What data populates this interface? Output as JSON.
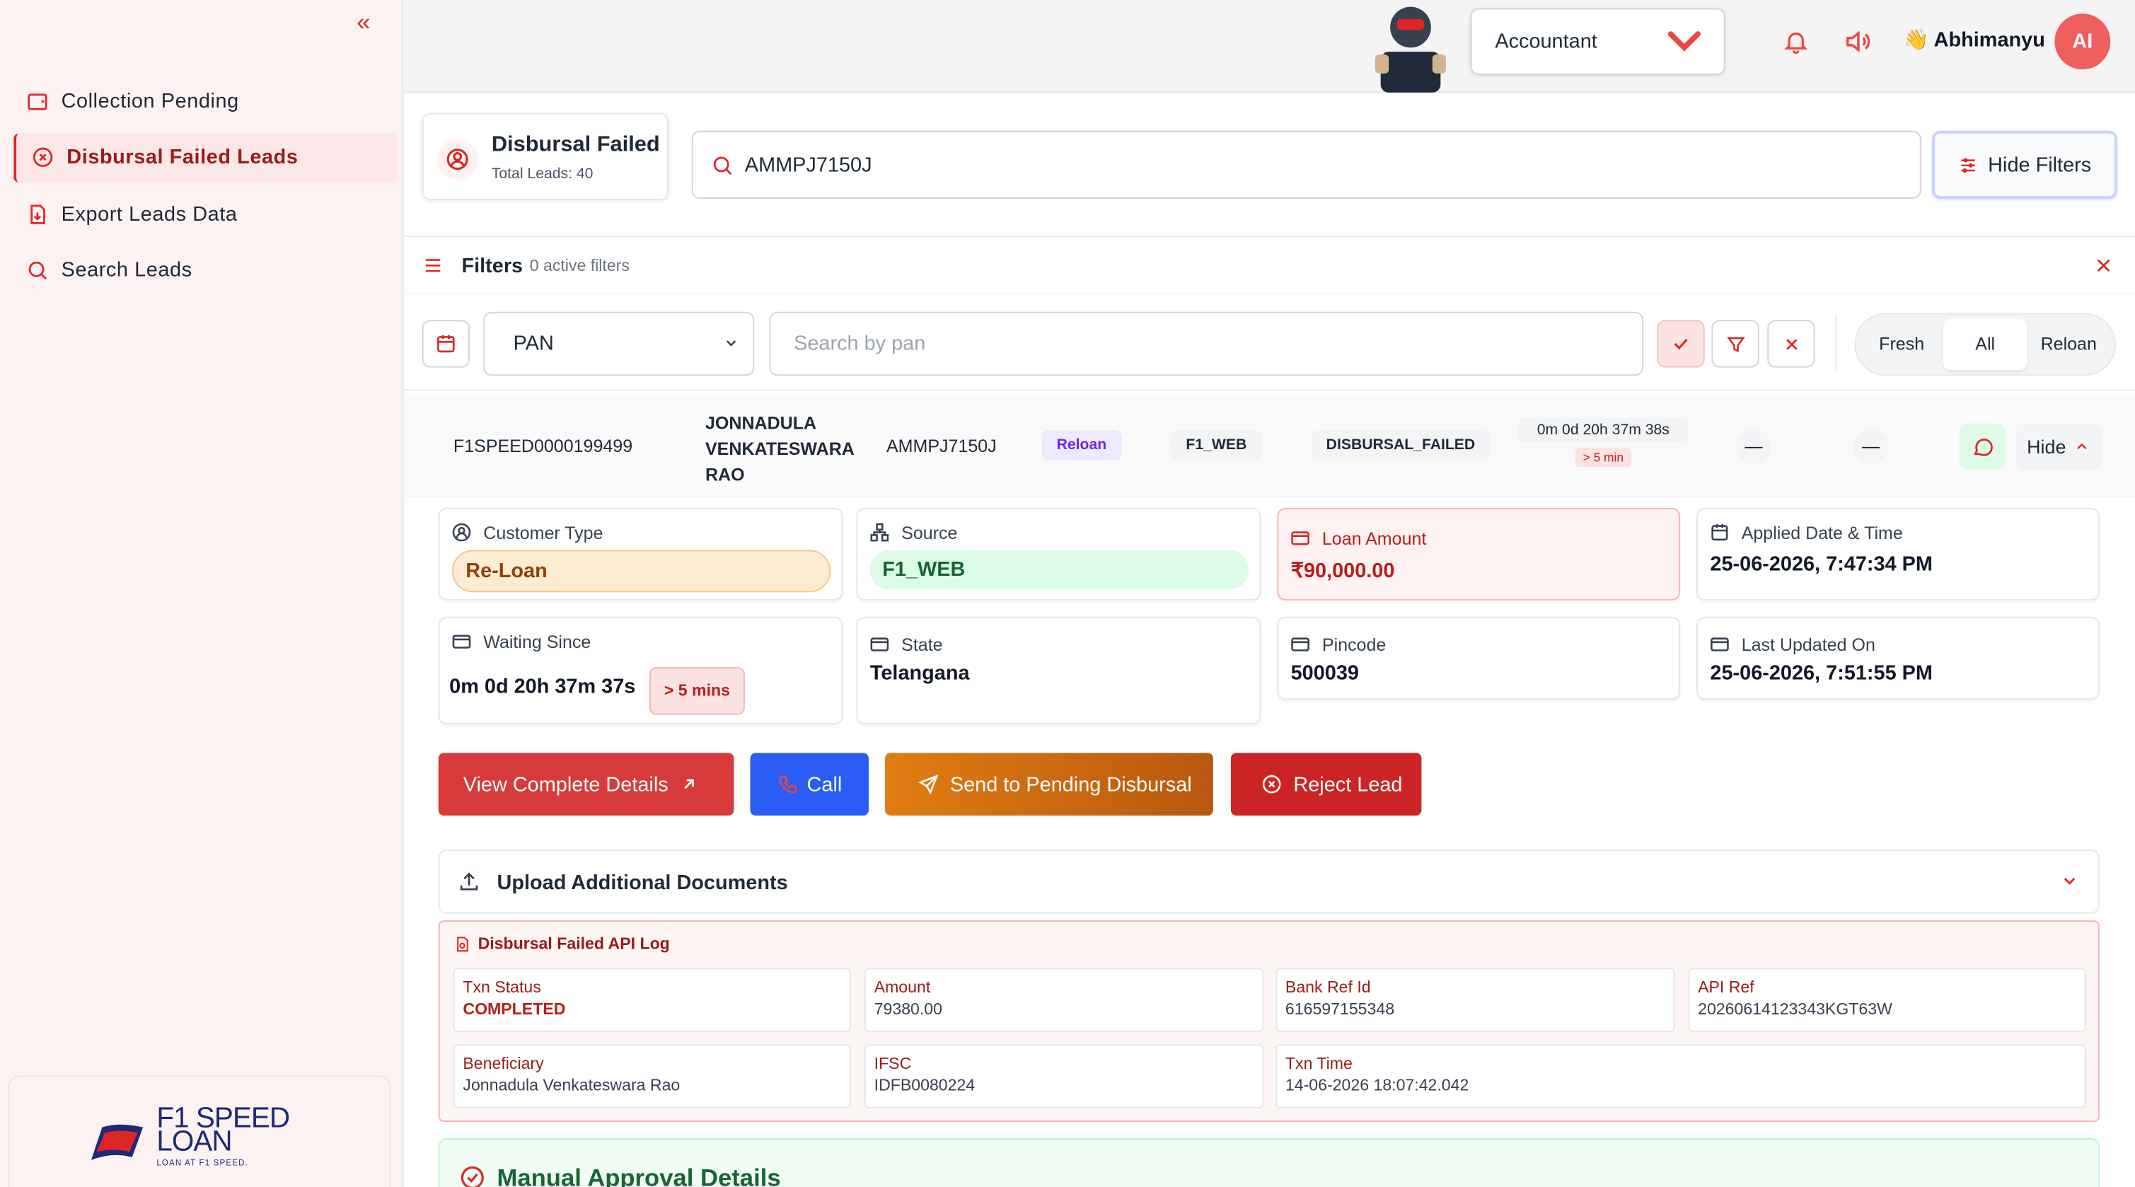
{
  "sidebar": {
    "items": [
      {
        "label": "Collection Pending",
        "icon": "wallet-icon"
      },
      {
        "label": "Disbursal Failed Leads",
        "icon": "x-circle-icon",
        "active": true
      },
      {
        "label": "Export Leads Data",
        "icon": "file-download-icon"
      },
      {
        "label": "Search Leads",
        "icon": "search-icon"
      }
    ],
    "logo": {
      "line1": "F1 SPEED",
      "line2": "LOAN",
      "tagline": "LOAN AT F1 SPEED."
    }
  },
  "topbar": {
    "role": "Accountant",
    "user_name": "Abhimanyu",
    "avatar_initials": "AI"
  },
  "header": {
    "title": "Disbursal Failed",
    "subtitle": "Total Leads: 40",
    "search_value": "AMMPJ7150J",
    "hide_filters_label": "Hide Filters"
  },
  "filters": {
    "label": "Filters",
    "active_count": "0 active filters",
    "field_select": "PAN",
    "search_placeholder": "Search by pan",
    "segments": [
      "Fresh",
      "All",
      "Reloan"
    ],
    "selected_segment": "All"
  },
  "lead": {
    "id": "F1SPEED0000199499",
    "name": "JONNADULA VENKATESWARA RAO",
    "pan": "AMMPJ7150J",
    "type_badge": "Reloan",
    "source_badge": "F1_WEB",
    "status_badge": "DISBURSAL_FAILED",
    "waiting_time": "0m 0d 20h 37m 38s",
    "waiting_badge": "> 5 min",
    "dash1": "—",
    "dash2": "—",
    "hide_label": "Hide"
  },
  "details": {
    "customer_type_label": "Customer Type",
    "customer_type_value": "Re-Loan",
    "source_label": "Source",
    "source_value": "F1_WEB",
    "loan_amount_label": "Loan Amount",
    "loan_amount_value": "₹90,000.00",
    "applied_label": "Applied Date & Time",
    "applied_value": "25-06-2026, 7:47:34 PM",
    "waiting_label": "Waiting Since",
    "waiting_value": "0m 0d 20h 37m 37s",
    "waiting_badge": "> 5 mins",
    "state_label": "State",
    "state_value": "Telangana",
    "pincode_label": "Pincode",
    "pincode_value": "500039",
    "updated_label": "Last Updated On",
    "updated_value": "25-06-2026, 7:51:55 PM"
  },
  "actions": {
    "view": "View Complete Details",
    "call": "Call",
    "send": "Send to Pending Disbursal",
    "reject": "Reject Lead"
  },
  "upload": {
    "label": "Upload Additional Documents"
  },
  "api_log": {
    "title": "Disbursal Failed API Log",
    "fields": [
      {
        "k": "Txn Status",
        "v": "COMPLETED"
      },
      {
        "k": "Amount",
        "v": "79380.00"
      },
      {
        "k": "Bank Ref Id",
        "v": "616597155348"
      },
      {
        "k": "API Ref",
        "v": "20260614123343KGT63W"
      },
      {
        "k": "Beneficiary",
        "v": "Jonnadula Venkateswara Rao"
      },
      {
        "k": "IFSC",
        "v": "IDFB0080224"
      },
      {
        "k": "Txn Time",
        "v": "14-06-2026 18:07:42.042"
      }
    ]
  },
  "manual": {
    "label": "Manual Approval Details"
  },
  "colors": {
    "accent": "#dc2626",
    "call": "#2b5cf5",
    "send": "#e07d12",
    "success": "#166534"
  }
}
